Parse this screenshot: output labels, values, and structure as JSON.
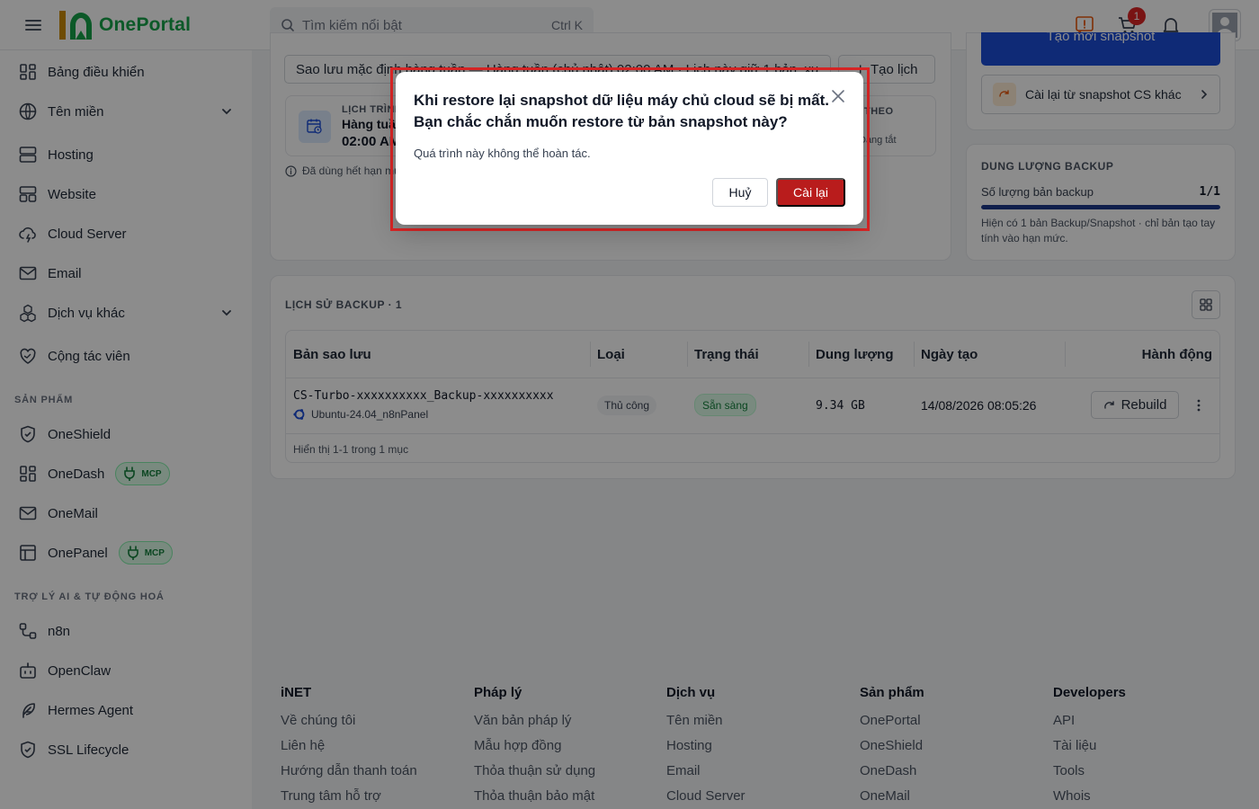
{
  "header": {
    "logo_text": "OnePortal",
    "search_placeholder": "Tìm kiếm nổi bật",
    "search_shortcut": "Ctrl K",
    "cart_count": "1"
  },
  "sidebar": {
    "items": [
      {
        "label": "Bảng điều khiển"
      },
      {
        "label": "Tên miền"
      },
      {
        "label": "Hosting"
      },
      {
        "label": "Website"
      },
      {
        "label": "Cloud Server"
      },
      {
        "label": "Email"
      },
      {
        "label": "Dịch vụ khác"
      },
      {
        "label": "Cộng tác viên"
      }
    ],
    "section_products": "SẢN PHẨM",
    "products": [
      {
        "label": "OneShield"
      },
      {
        "label": "OneDash",
        "badge": "MCP"
      },
      {
        "label": "OneMail"
      },
      {
        "label": "OnePanel",
        "badge": "MCP"
      }
    ],
    "section_ai": "TRỢ LÝ AI & TỰ ĐỘNG HOÁ",
    "ai": [
      {
        "label": "n8n"
      },
      {
        "label": "OpenClaw"
      },
      {
        "label": "Hermes Agent"
      },
      {
        "label": "SSL Lifecycle"
      }
    ]
  },
  "schedule": {
    "select_value": "Sao lưu mặc định hàng tuần — Hàng tuần (chủ nhật) 02:00 AM · Lịch này giữ 1 bản, xu",
    "create_label": "Tạo lịch",
    "box_label": "LỊCH TRÌNH",
    "box_value_1": "Hàng tuần",
    "box_value_2": "02:00 AM",
    "right_label": "THEO",
    "right_value": "Đang tắt",
    "note": "Đã dùng hết hạn mức"
  },
  "right_panel": {
    "new_snapshot_label": "Tạo mới snapshot",
    "restore_other_label": "Cài lại từ snapshot CS khác",
    "storage_title": "DUNG LƯỢNG BACKUP",
    "count_label": "Số lượng bản backup",
    "count_value": "1/1",
    "usage_fraction": 1.0,
    "note": "Hiện có 1 bản Backup/Snapshot · chỉ bản tạo tay tính vào hạn mức."
  },
  "history": {
    "title": "LỊCH SỬ BACKUP · 1",
    "columns": [
      "Bản sao lưu",
      "Loại",
      "Trạng thái",
      "Dung lượng",
      "Ngày tạo",
      "Hành động"
    ],
    "rows": [
      {
        "name": "CS-Turbo-xxxxxxxxxx_Backup-xxxxxxxxxx",
        "os": "Ubuntu-24.04_n8nPanel",
        "type": "Thủ công",
        "status": "Sẵn sàng",
        "size": "9.34 GB",
        "created": "14/08/2026 08:05:26",
        "action": "Rebuild"
      }
    ],
    "footer": "Hiển thị 1-1 trong 1 mục"
  },
  "footer": {
    "columns": [
      {
        "title": "iNET",
        "links": [
          "Về chúng tôi",
          "Liên hệ",
          "Hướng dẫn thanh toán",
          "Trung tâm hỗ trợ"
        ]
      },
      {
        "title": "Pháp lý",
        "links": [
          "Văn bản pháp lý",
          "Mẫu hợp đồng",
          "Thỏa thuận sử dụng",
          "Thỏa thuận bảo mật"
        ]
      },
      {
        "title": "Dịch vụ",
        "links": [
          "Tên miền",
          "Hosting",
          "Email",
          "Cloud Server"
        ]
      },
      {
        "title": "Sản phẩm",
        "links": [
          "OnePortal",
          "OneShield",
          "OneDash",
          "OneMail"
        ]
      },
      {
        "title": "Developers",
        "links": [
          "API",
          "Tài liệu",
          "Tools",
          "Whois"
        ]
      }
    ]
  },
  "modal": {
    "title": "Khi restore lại snapshot dữ liệu máy chủ cloud sẽ bị mất. Bạn chắc chắn muốn restore từ bản snapshot này?",
    "description": "Quá trình này không thể hoàn tác.",
    "cancel_label": "Huỷ",
    "confirm_label": "Cài lại"
  },
  "colors": {
    "brand_green": "#16a34a",
    "primary_blue": "#1d4ed8",
    "danger_red": "#b91c1c"
  }
}
